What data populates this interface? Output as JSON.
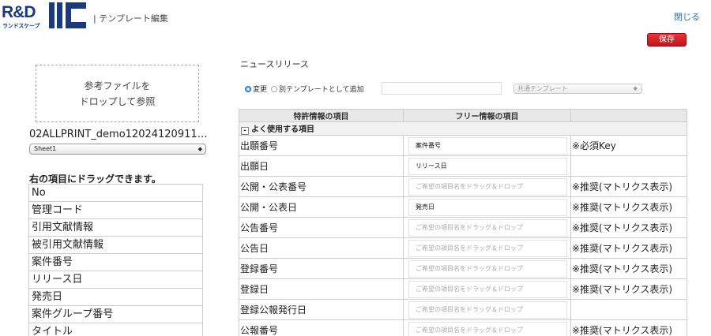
{
  "header": {
    "logo_text": "R&D",
    "logo_sub": "ランドスケープ",
    "title": "| テンプレート編集",
    "close_label": "閉じる",
    "save_label": "保存"
  },
  "left": {
    "drop_zone_line1": "参考ファイルを",
    "drop_zone_line2": "ドロップして参照",
    "filename": "02ALLPRINT_demo12024120911…",
    "sheet_selected": "Sheet1",
    "drag_title": "右の項目にドラッグできます。",
    "items": [
      "No",
      "管理コード",
      "引用文献情報",
      "被引用文献情報",
      "案件番号",
      "リリース日",
      "発売日",
      "案件グループ番号",
      "タイトル"
    ]
  },
  "right": {
    "template_name": "ニュースリリース",
    "radio_change": "変更",
    "radio_add": "別テンプレートとして追加",
    "common_template": "共通テンプレート",
    "table": {
      "col_patent": "特許情報の項目",
      "col_free": "フリー情報の項目",
      "group_label": "よく使用する項目",
      "toggle": "-",
      "placeholder": "ご希望の項目名をドラッグ＆ドロップ",
      "rows": [
        {
          "patent": "出願番号",
          "free": "案件番号",
          "note": "※必須Key",
          "note_type": "required"
        },
        {
          "patent": "出願日",
          "free": "リリース日",
          "note": "",
          "note_type": ""
        },
        {
          "patent": "公開・公表番号",
          "free": "",
          "note": "※推奨(マトリクス表示)",
          "note_type": "recommended"
        },
        {
          "patent": "公開・公表日",
          "free": "発売日",
          "note": "※推奨(マトリクス表示)",
          "note_type": "recommended"
        },
        {
          "patent": "公告番号",
          "free": "",
          "note": "※推奨(マトリクス表示)",
          "note_type": "recommended"
        },
        {
          "patent": "公告日",
          "free": "",
          "note": "※推奨(マトリクス表示)",
          "note_type": "recommended"
        },
        {
          "patent": "登録番号",
          "free": "",
          "note": "※推奨(マトリクス表示)",
          "note_type": "recommended"
        },
        {
          "patent": "登録日",
          "free": "",
          "note": "※推奨(マトリクス表示)",
          "note_type": "recommended"
        },
        {
          "patent": "登録公報発行日",
          "free": "",
          "note": "",
          "note_type": ""
        },
        {
          "patent": "公報番号",
          "free": "",
          "note": "※推奨(マトリクス表示)",
          "note_type": "recommended"
        }
      ]
    }
  },
  "colors": {
    "brand": "#1b3a7a",
    "save": "#d0202a",
    "required": "#e01010",
    "recommended": "#2a8ad0",
    "link": "#2a6fb5"
  }
}
